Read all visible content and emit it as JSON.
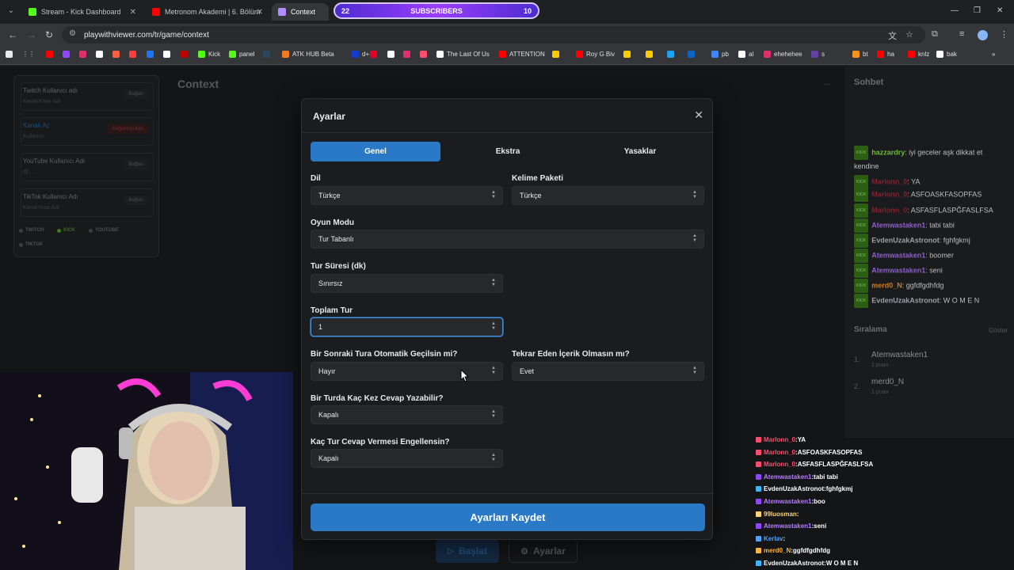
{
  "browser": {
    "tabs": [
      {
        "title": "Stream - Kick Dashboard",
        "color": "#53fc18"
      },
      {
        "title": "Metronom Akademi | 6. Bölüm",
        "color": "#ff0000"
      },
      {
        "title": "Context",
        "color": "#b18cff"
      }
    ],
    "subscribers": {
      "left": "22",
      "label": "SUBSCRIBERS",
      "right": "10"
    },
    "url": "playwithviewer.com/tr/game/context",
    "bookmarks": [
      {
        "label": "",
        "color": "#ff0000"
      },
      {
        "label": "",
        "color": "#9146ff"
      },
      {
        "label": "",
        "color": "#e1306c"
      },
      {
        "label": "",
        "color": "#ffffff"
      },
      {
        "label": "",
        "color": "#f56040"
      },
      {
        "label": "",
        "color": "#ff3d3d"
      },
      {
        "label": "",
        "color": "#1877f2"
      },
      {
        "label": "",
        "color": "#ffffff"
      },
      {
        "label": "",
        "color": "#c00000"
      },
      {
        "label": "Kick",
        "color": "#53fc18"
      },
      {
        "label": "panel",
        "color": "#53fc18"
      },
      {
        "label": "",
        "color": "#2a475e"
      },
      {
        "label": "ATK HUB Beta",
        "color": "#f07b20"
      },
      {
        "label": "d+",
        "color": "#113ccf"
      },
      {
        "label": "",
        "color": "#e60023"
      },
      {
        "label": "",
        "color": "#ffffff"
      },
      {
        "label": "",
        "color": "#e1306c"
      },
      {
        "label": "",
        "color": "#ff4d6d"
      },
      {
        "label": "The Last Of Us",
        "color": "#ffffff"
      },
      {
        "label": "ATTENTION",
        "color": "#ff0000"
      },
      {
        "label": "",
        "color": "#ffcc00"
      },
      {
        "label": "Roy G Biv",
        "color": "#ff0000"
      },
      {
        "label": "",
        "color": "#ffcc00"
      },
      {
        "label": "",
        "color": "#ffcc00"
      },
      {
        "label": "",
        "color": "#1da1f2"
      },
      {
        "label": "",
        "color": "#0a66c2"
      },
      {
        "label": "pb",
        "color": "#4285f4"
      },
      {
        "label": "al",
        "color": "#ffffff"
      },
      {
        "label": "ehehehee",
        "color": "#e1306c"
      },
      {
        "label": "s",
        "color": "#6441a5"
      },
      {
        "label": "bt",
        "color": "#f7931a"
      },
      {
        "label": "ha",
        "color": "#ff0000"
      },
      {
        "label": "knlz",
        "color": "#ff0000"
      },
      {
        "label": "bak",
        "color": "#ffffff"
      }
    ]
  },
  "left_panel": {
    "items": [
      {
        "label": "Twitch Kullanıcı adı",
        "sub": "Kanal Katılı Adı",
        "button": "Bağlan"
      },
      {
        "label": "Kanalı Aç",
        "sub": "Kullanıcı",
        "button": "Bağlantıyı Kes"
      },
      {
        "label": "YouTube Kullanıcı Adı",
        "sub": "@...",
        "button": "Bağlan"
      },
      {
        "label": "TikTok Kullanıcı Adı",
        "sub": "Kanal Kısa Adı",
        "button": "Bağlan"
      }
    ],
    "platforms": [
      "TWITCH",
      "KICK",
      "YOUTUBE",
      "TIKTOK"
    ]
  },
  "context_title": "Context",
  "chat": {
    "title": "Sohbet",
    "tag": "KICK",
    "messages": [
      {
        "user": "hazzardry",
        "text": "iyi geceler aşk dikkat et kendine",
        "color": "#6dbb3c"
      },
      {
        "user": "Marlonn_0",
        "text": "YA",
        "color": "#8a1f2a"
      },
      {
        "user": "Marlonn_0",
        "text": "ASFOASKFASOPFAS",
        "color": "#8a1f2a"
      },
      {
        "user": "Marlonn_0",
        "text": "ASFASFLASPĞFASLFSA",
        "color": "#8a1f2a"
      },
      {
        "user": "Atemwastaken1",
        "text": "tabi tabi",
        "color": "#8e5fc9"
      },
      {
        "user": "EvdenUzakAstronot",
        "text": "fghfgkmj",
        "color": "#9aa0a6"
      },
      {
        "user": "Atemwastaken1",
        "text": "boomer",
        "color": "#8e5fc9"
      },
      {
        "user": "Atemwastaken1",
        "text": "seni",
        "color": "#8e5fc9"
      },
      {
        "user": "merd0_N",
        "text": "ggfdfgdhfdg",
        "color": "#d07a1a"
      },
      {
        "user": "EvdenUzakAstronot",
        "text": "W O M E N",
        "color": "#9aa0a6"
      }
    ],
    "ranking_title": "Sıralama",
    "ranking_show": "Göster",
    "ranking": [
      {
        "rank": "1.",
        "name": "Atemwastaken1",
        "points": "1 puan"
      },
      {
        "rank": "2.",
        "name": "merd0_N",
        "points": "1 puan"
      }
    ]
  },
  "bottom_buttons": {
    "start": "Başlat",
    "settings": "Ayarlar"
  },
  "overlay_chat": [
    {
      "user": "Marlonn_0",
      "text": "YA",
      "color": "#ff4d6d",
      "icon": "#ff4d6d"
    },
    {
      "user": "Marlonn_0",
      "text": "ASFOASKFASOPFAS",
      "color": "#ff4d6d",
      "icon": "#ff4d6d"
    },
    {
      "user": "Marlonn_0",
      "text": "ASFASFLASPĞFASLFSA",
      "color": "#ff4d6d",
      "icon": "#ff4d6d"
    },
    {
      "user": "Atemwastaken1",
      "text": "tabi tabi",
      "color": "#b77cff",
      "icon": "#9146ff"
    },
    {
      "user": "EvdenUzakAstronot",
      "text": "fghfgkmj",
      "color": "#ffffff",
      "icon": "#3fb4ff"
    },
    {
      "user": "Atemwastaken1",
      "text": "boo",
      "color": "#b77cff",
      "icon": "#9146ff"
    },
    {
      "user": "99luosman",
      "text": "",
      "color": "#ffd27a",
      "icon": "#ffd27a"
    },
    {
      "user": "Atemwastaken1",
      "text": "seni",
      "color": "#b77cff",
      "icon": "#9146ff"
    },
    {
      "user": "Kerlav",
      "text": "",
      "color": "#4fa3ff",
      "icon": "#4fa3ff"
    },
    {
      "user": "merd0_N",
      "text": "ggfdfgdhfdg",
      "color": "#ffb347",
      "icon": "#ffb347"
    },
    {
      "user": "EvdenUzakAstronot",
      "text": "W O M E N",
      "color": "#ffffff",
      "icon": "#3fb4ff"
    }
  ],
  "modal": {
    "title": "Ayarlar",
    "tabs": [
      "Genel",
      "Ekstra",
      "Yasaklar"
    ],
    "active_tab": "Genel",
    "fields": {
      "language": {
        "label": "Dil",
        "value": "Türkçe"
      },
      "word_pack": {
        "label": "Kelime Paketi",
        "value": "Türkçe"
      },
      "game_mode": {
        "label": "Oyun Modu",
        "value": "Tur Tabanlı"
      },
      "round_duration": {
        "label": "Tur Süresi (dk)",
        "value": "Sınırsız"
      },
      "total_rounds": {
        "label": "Toplam Tur",
        "value": "1"
      },
      "auto_next": {
        "label": "Bir Sonraki Tura Otomatik Geçilsin mi?",
        "value": "Hayır"
      },
      "no_repeat": {
        "label": "Tekrar Eden İçerik Olmasın mı?",
        "value": "Evet"
      },
      "answers_per_round": {
        "label": "Bir Turda Kaç Kez Cevap Yazabilir?",
        "value": "Kapalı"
      },
      "block_rounds": {
        "label": "Kaç Tur Cevap Vermesi Engellensin?",
        "value": "Kapalı"
      }
    },
    "save_label": "Ayarları Kaydet",
    "accent": "#2979c7"
  }
}
